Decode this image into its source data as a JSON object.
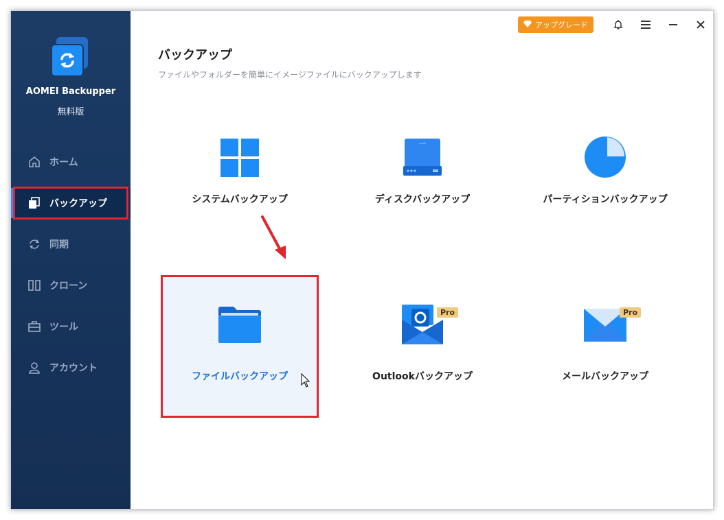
{
  "sidebar": {
    "app_name": "AOMEI Backupper",
    "edition": "無料版",
    "items": [
      {
        "label": "ホーム",
        "icon": "home-icon"
      },
      {
        "label": "バックアップ",
        "icon": "backup-icon",
        "active": true
      },
      {
        "label": "同期",
        "icon": "sync-icon"
      },
      {
        "label": "クローン",
        "icon": "clone-icon"
      },
      {
        "label": "ツール",
        "icon": "tools-icon"
      },
      {
        "label": "アカウント",
        "icon": "account-icon"
      }
    ]
  },
  "topbar": {
    "upgrade_label": "アップグレード",
    "icons": [
      "bell-icon",
      "menu-icon",
      "minimize-icon",
      "close-icon"
    ]
  },
  "main": {
    "title": "バックアップ",
    "subtitle": "ファイルやフォルダーを簡単にイメージファイルにバックアップします",
    "cards": [
      {
        "label": "システムバックアップ",
        "icon": "windows-icon"
      },
      {
        "label": "ディスクバックアップ",
        "icon": "disk-icon"
      },
      {
        "label": "パーティションバックアップ",
        "icon": "partition-pie-icon"
      },
      {
        "label": "ファイルバックアップ",
        "icon": "folder-icon",
        "selected": true
      },
      {
        "label": "Outlookバックアップ",
        "icon": "outlook-icon",
        "badge": "Pro"
      },
      {
        "label": "メールバックアップ",
        "icon": "mail-icon",
        "badge": "Pro"
      }
    ]
  },
  "colors": {
    "sidebar": "#1c3c66",
    "accent": "#2073d8",
    "upgrade": "#f4951f",
    "highlight": "#e0262f",
    "pro_badge": "#efc97f"
  }
}
